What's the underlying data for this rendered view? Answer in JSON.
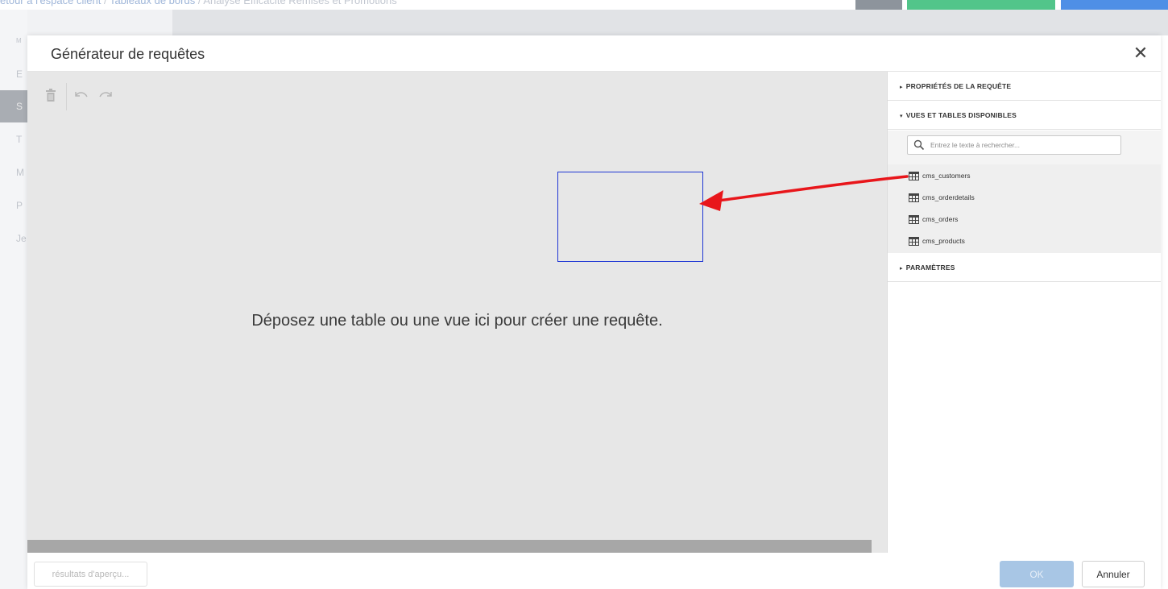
{
  "background": {
    "breadcrumb": {
      "part1": "etour à l'espace client",
      "sep1": " / ",
      "part2": "Tableaux de bords",
      "sep2": " / ",
      "part3": "Analyse Efficacité Remises et Promotions"
    },
    "sidebar_letters": [
      "M",
      "E",
      "S",
      "T",
      "M",
      "P",
      "Je"
    ]
  },
  "modal": {
    "title": "Générateur de requêtes",
    "close_symbol": "✕"
  },
  "toolbar": {
    "delete_icon": "trash-icon",
    "undo_icon": "undo-icon",
    "redo_icon": "redo-icon"
  },
  "designer": {
    "drop_hint": "Déposez une table ou une vue ici pour créer une requête."
  },
  "side_panel": {
    "sections": {
      "properties": "PROPRIÉTÉS DE LA REQUÊTE",
      "views": "VUES ET TABLES DISPONIBLES",
      "parameters": "PARAMÈTRES"
    },
    "tri_collapsed": "▸",
    "tri_expanded": "▾",
    "search_placeholder": "Entrez le texte à rechercher...",
    "tables": [
      {
        "name": "cms_customers",
        "icon": "table-icon"
      },
      {
        "name": "cms_orderdetails",
        "icon": "table-icon"
      },
      {
        "name": "cms_orders",
        "icon": "table-icon"
      },
      {
        "name": "cms_products",
        "icon": "table-icon"
      }
    ]
  },
  "footer": {
    "preview_label": "résultats d'aperçu...",
    "ok_label": "OK",
    "cancel_label": "Annuler"
  },
  "colors": {
    "annotation_arrow": "#e8161b",
    "drop_rect": "#1f36d4",
    "ok_button": "#a8c6e5"
  }
}
